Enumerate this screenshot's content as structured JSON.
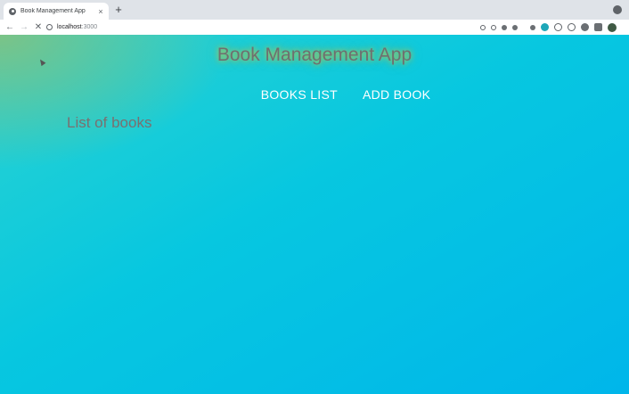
{
  "browser": {
    "tab_title": "Book Management App",
    "tab_close": "×",
    "new_tab": "+",
    "back": "←",
    "forward": "→",
    "stop": "✕",
    "url_host": "localhost",
    "url_port": ":3000"
  },
  "app": {
    "title": "Book Management App",
    "nav": {
      "books_list": "BOOKS LIST",
      "add_book": "ADD BOOK"
    },
    "section_heading": "List of books"
  },
  "colors": {
    "background_start": "#2cd3d0",
    "background_end": "#00b6ea",
    "title_glow": "#d2c83c",
    "nav_text": "#ffffff"
  }
}
